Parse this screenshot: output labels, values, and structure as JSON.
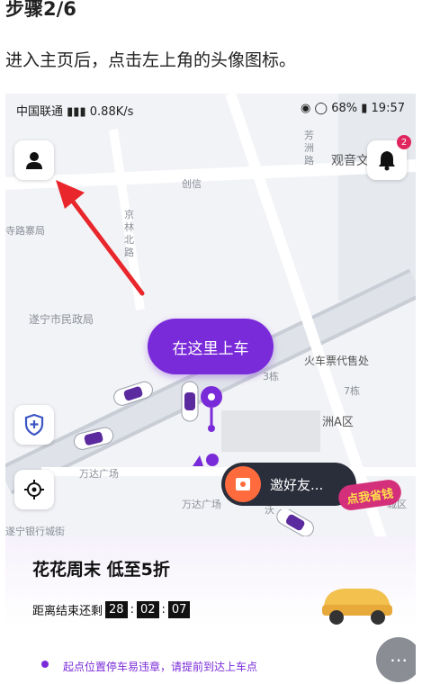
{
  "step_title": "步骤2/6",
  "instruction": "进入主页后，点击左上角的头像图标。",
  "status_bar": {
    "carrier": "中国联通",
    "speed": "0.88K/s",
    "battery": "68%",
    "time": "19:57"
  },
  "map": {
    "labels": [
      "芳",
      "洲",
      "路",
      "观音文",
      "创信",
      "寺路寨局",
      "京",
      "林",
      "北",
      "路",
      "遂宁市民政局",
      "火车票代售处",
      "3栋",
      "7栋",
      "洲A区",
      "万达广场",
      "万达广场",
      "沃",
      "遂宁银行城街",
      "城区"
    ],
    "pickup_label": "在这里上车",
    "notification_count": "2",
    "invite_label": "邀好友...",
    "money_label": "点我省钱"
  },
  "promo": {
    "title": "花花周末 低至5折",
    "countdown_label": "距离结束还剩",
    "hours": "28",
    "minutes": "02",
    "seconds": "07",
    "notice": "起点位置停车易违章，请提前到达上车点"
  },
  "colors": {
    "accent_purple": "#7a2bd9",
    "arrow_red": "#e8262b"
  }
}
